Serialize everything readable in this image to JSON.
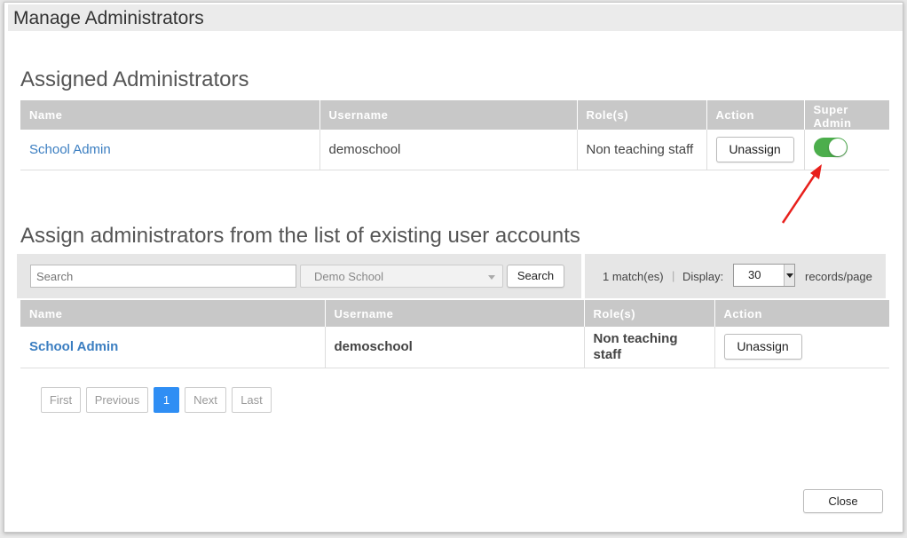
{
  "dialog": {
    "title": "Manage Administrators"
  },
  "assigned": {
    "heading": "Assigned Administrators",
    "columns": {
      "name": "Name",
      "username": "Username",
      "roles": "Role(s)",
      "action": "Action",
      "super_admin": "Super Admin"
    },
    "rows": [
      {
        "name": "School Admin",
        "username": "demoschool",
        "roles": "Non teaching staff",
        "action": "Unassign",
        "super_admin": true
      }
    ]
  },
  "assign": {
    "heading": "Assign administrators from the list of existing user accounts",
    "toolbar": {
      "search_placeholder": "Search",
      "school_select": "Demo School",
      "search_button": "Search",
      "match_count": "1 match(es)",
      "separator": "|",
      "display_label": "Display:",
      "display_value": "30",
      "records_label": "records/page"
    },
    "columns": {
      "name": "Name",
      "username": "Username",
      "roles": "Role(s)",
      "action": "Action"
    },
    "rows": [
      {
        "name": "School Admin",
        "username": "demoschool",
        "roles": "Non teaching staff",
        "action": "Unassign"
      }
    ]
  },
  "pager": {
    "first": "First",
    "previous": "Previous",
    "current": "1",
    "next": "Next",
    "last": "Last"
  },
  "footer": {
    "close": "Close"
  },
  "colors": {
    "toggle_on": "#4cae4c",
    "link": "#3b7ec1",
    "active_page": "#2f8ef4",
    "annotation_arrow": "#e8201c"
  }
}
